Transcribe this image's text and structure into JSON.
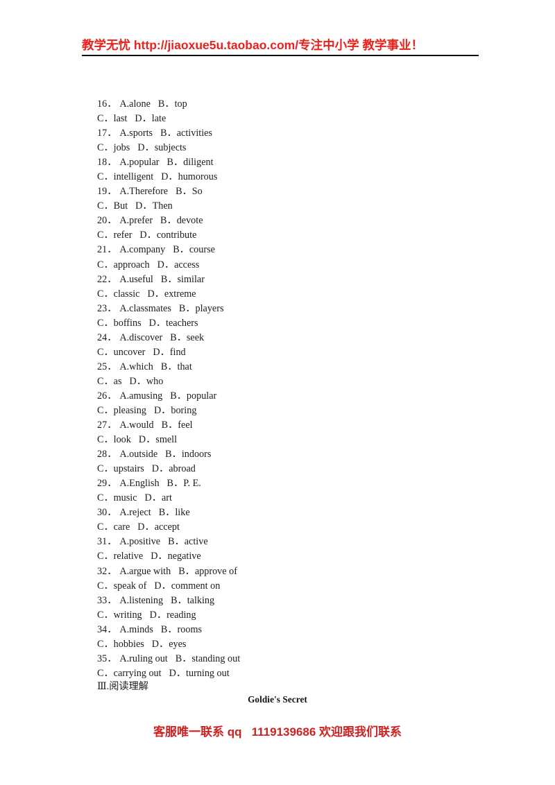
{
  "header": {
    "banner_text": "教学无忧 http://jiaoxue5u.taobao.com/专注中小学  教学事业！",
    "banner_color": "#e8221c",
    "rule_color": "#000000"
  },
  "questions": [
    {
      "number": "16．",
      "a": "A.alone",
      "b": "B．top",
      "c": "C．last",
      "d": "D．late"
    },
    {
      "number": "17．",
      "a": "A.sports",
      "b": "B．activities",
      "c": "C．jobs",
      "d": "D．subjects"
    },
    {
      "number": "18．",
      "a": "A.popular",
      "b": "B．diligent",
      "c": "C．intelligent",
      "d": "D．humorous"
    },
    {
      "number": "19．",
      "a": "A.Therefore",
      "b": "B．So",
      "c": "C．But",
      "d": "D．Then"
    },
    {
      "number": "20．",
      "a": "A.prefer",
      "b": "B．devote",
      "c": "C．refer",
      "d": "D．contribute"
    },
    {
      "number": "21．",
      "a": "A.company",
      "b": "B．course",
      "c": "C．approach",
      "d": "D．access"
    },
    {
      "number": "22．",
      "a": "A.useful",
      "b": "B．similar",
      "c": "C．classic",
      "d": "D．extreme"
    },
    {
      "number": "23．",
      "a": "A.classmates",
      "b": "B．players",
      "c": "C．boffins",
      "d": "D．teachers"
    },
    {
      "number": "24．",
      "a": "A.discover",
      "b": "B．seek",
      "c": "C．uncover",
      "d": "D．find"
    },
    {
      "number": "25．",
      "a": "A.which",
      "b": "B．that",
      "c": "C．as",
      "d": "D．who"
    },
    {
      "number": "26．",
      "a": "A.amusing",
      "b": "B．popular",
      "c": "C．pleasing",
      "d": "D．boring"
    },
    {
      "number": "27．",
      "a": "A.would",
      "b": "B．feel",
      "c": "C．look",
      "d": "D．smell"
    },
    {
      "number": "28．",
      "a": "A.outside",
      "b": "B．indoors",
      "c": "C．upstairs",
      "d": "D．abroad"
    },
    {
      "number": "29．",
      "a": "A.English",
      "b": "B．P. E.",
      "c": "C．music",
      "d": "D．art"
    },
    {
      "number": "30．",
      "a": "A.reject",
      "b": "B．like",
      "c": "C．care",
      "d": "D．accept"
    },
    {
      "number": "31．",
      "a": "A.positive",
      "b": "B．active",
      "c": "C．relative",
      "d": "D．negative"
    },
    {
      "number": "32．",
      "a": "A.argue with",
      "b": "B．approve of",
      "c": "C．speak of",
      "d": "D．comment on"
    },
    {
      "number": "33．",
      "a": "A.listening",
      "b": "B．talking",
      "c": "C．writing",
      "d": "D．reading"
    },
    {
      "number": "34．",
      "a": "A.minds",
      "b": "B．rooms",
      "c": "C．hobbies",
      "d": "D．eyes"
    },
    {
      "number": "35．",
      "a": "A.ruling out",
      "b": "B．standing out",
      "c": "C．carrying out",
      "d": "D．turning out"
    }
  ],
  "section": {
    "heading": "Ⅲ.阅读理解"
  },
  "passage": {
    "title": "Goldie's Secret"
  },
  "footer": {
    "text": "客服唯一联系 qq   1119139686 欢迎跟我们联系",
    "color": "#cc2222"
  }
}
